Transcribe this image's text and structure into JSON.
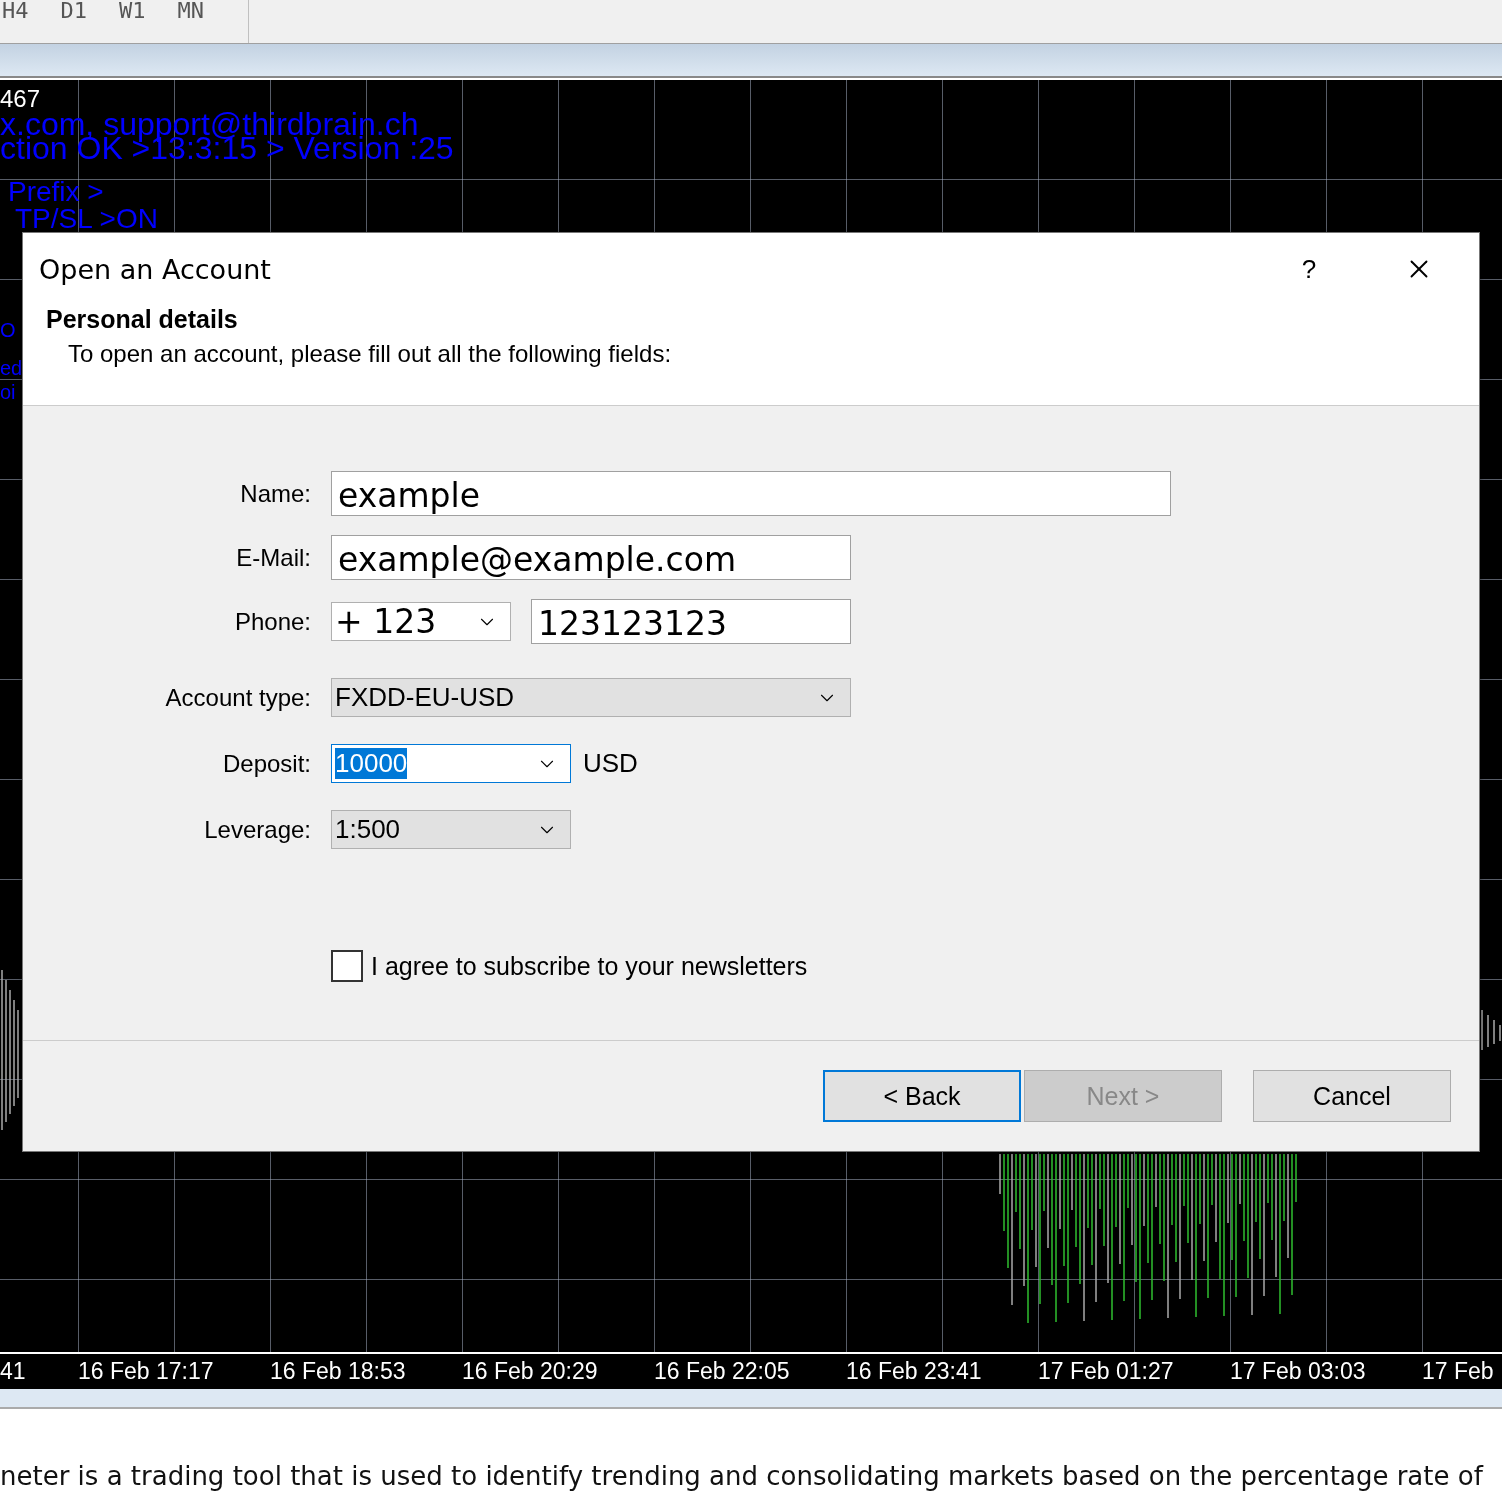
{
  "toolbar": {
    "timeframes": [
      "H4",
      "D1",
      "W1",
      "MN"
    ]
  },
  "chart": {
    "overlay_texts": [
      {
        "text": "467",
        "kind": "value"
      },
      {
        "text": "x.com, support@thirdbrain.ch",
        "kind": "info"
      },
      {
        "text": "ction OK >13:3:15 > Version :25",
        "kind": "info"
      },
      {
        "text": "Prefix >",
        "kind": "setting"
      },
      {
        "text": "TP/SL >ON",
        "kind": "setting"
      },
      {
        "text": "O",
        "kind": "edge"
      },
      {
        "text": "ed",
        "kind": "edge"
      },
      {
        "text": "oi",
        "kind": "edge"
      }
    ],
    "time_axis": [
      "41",
      "16 Feb 17:17",
      "16 Feb 18:53",
      "16 Feb 20:29",
      "16 Feb 22:05",
      "16 Feb 23:41",
      "17 Feb 01:27",
      "17 Feb 03:03",
      "17 Feb"
    ]
  },
  "dialog": {
    "title": "Open an Account",
    "help": "?",
    "section_title": "Personal details",
    "section_hint": "To open an account, please fill out all the following fields:",
    "fields": [
      {
        "label": "Name:",
        "kind": "text",
        "value": "example"
      },
      {
        "label": "E-Mail:",
        "kind": "text",
        "value": "example@example.com"
      },
      {
        "label": "Phone:",
        "kind": "phone",
        "code": "+ 123",
        "value": "123123123"
      },
      {
        "label": "Account type:",
        "kind": "select",
        "value": "FXDD-EU-USD"
      },
      {
        "label": "Deposit:",
        "kind": "combo",
        "value": "10000",
        "focused": true,
        "unit": "USD"
      },
      {
        "label": "Leverage:",
        "kind": "select",
        "value": "1:500"
      }
    ],
    "newsletter": {
      "label": "I agree to subscribe to your newsletters",
      "checked": false
    },
    "buttons": [
      {
        "label": "< Back",
        "focused": true,
        "disabled": false
      },
      {
        "label": "Next >",
        "focused": false,
        "disabled": true
      },
      {
        "label": "Cancel",
        "focused": false,
        "disabled": false
      }
    ]
  },
  "article": {
    "text": "neter is a trading tool that is used to identify trending and consolidating markets based on the percentage rate of"
  }
}
